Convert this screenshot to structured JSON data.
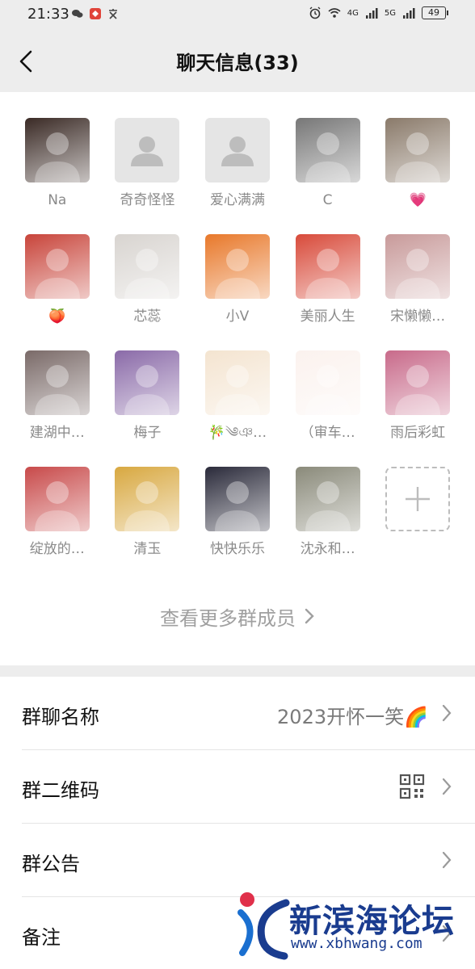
{
  "status_bar": {
    "time": "21:33",
    "network_1": "4G",
    "network_2": "5G",
    "battery": "49"
  },
  "nav": {
    "title": "聊天信息(33)"
  },
  "members": [
    {
      "name": "Na",
      "avatar": "photo-portrait",
      "color": "#3a2a25"
    },
    {
      "name": "奇奇怪怪",
      "avatar": "default-person",
      "color": "#e5e5e5"
    },
    {
      "name": "爱心满满",
      "avatar": "default-person",
      "color": "#e5e5e5"
    },
    {
      "name": "C",
      "avatar": "photo-bw",
      "color": "#777777"
    },
    {
      "name": "💗",
      "avatar": "photo-girl-room",
      "color": "#8a7a6a"
    },
    {
      "name": "🍑",
      "avatar": "photo-girl-red",
      "color": "#c8443a"
    },
    {
      "name": "芯蕊",
      "avatar": "photo-girl-white",
      "color": "#d8d4d0"
    },
    {
      "name": "小V",
      "avatar": "bunny-fa-cai",
      "color": "#e8782a"
    },
    {
      "name": "美丽人生",
      "avatar": "bunny-red",
      "color": "#d84a3a"
    },
    {
      "name": "宋懒懒…",
      "avatar": "photo-girl-pink",
      "color": "#c89a9a"
    },
    {
      "name": "建湖中…",
      "avatar": "photo-zto",
      "color": "#7a6a68"
    },
    {
      "name": "梅子",
      "avatar": "flower-purple",
      "color": "#8a6aa8"
    },
    {
      "name": "🎋༄ঞ…",
      "avatar": "cartoon-god",
      "color": "#f4e4d0"
    },
    {
      "name": "（审车…",
      "avatar": "cartoon-girl",
      "color": "#fbf2ee"
    },
    {
      "name": "雨后彩虹",
      "avatar": "flower-pink",
      "color": "#c86a8a"
    },
    {
      "name": "绽放的…",
      "avatar": "photo-woman-red",
      "color": "#c84a4a"
    },
    {
      "name": "清玉",
      "avatar": "photo-sunflower",
      "color": "#d8a840"
    },
    {
      "name": "快快乐乐",
      "avatar": "photo-night-fountain",
      "color": "#2a2a3a"
    },
    {
      "name": "沈永和…",
      "avatar": "photo-woman",
      "color": "#8a8a7a"
    }
  ],
  "add_member_icon": "plus-icon",
  "more_members": "查看更多群成员",
  "settings": {
    "group_name_label": "群聊名称",
    "group_name_value": "2023开怀一笑🌈",
    "qr_label": "群二维码",
    "notice_label": "群公告",
    "remark_label": "备注"
  },
  "watermark": {
    "text": "新滨海论坛",
    "url": "www.xbhwang.com"
  }
}
